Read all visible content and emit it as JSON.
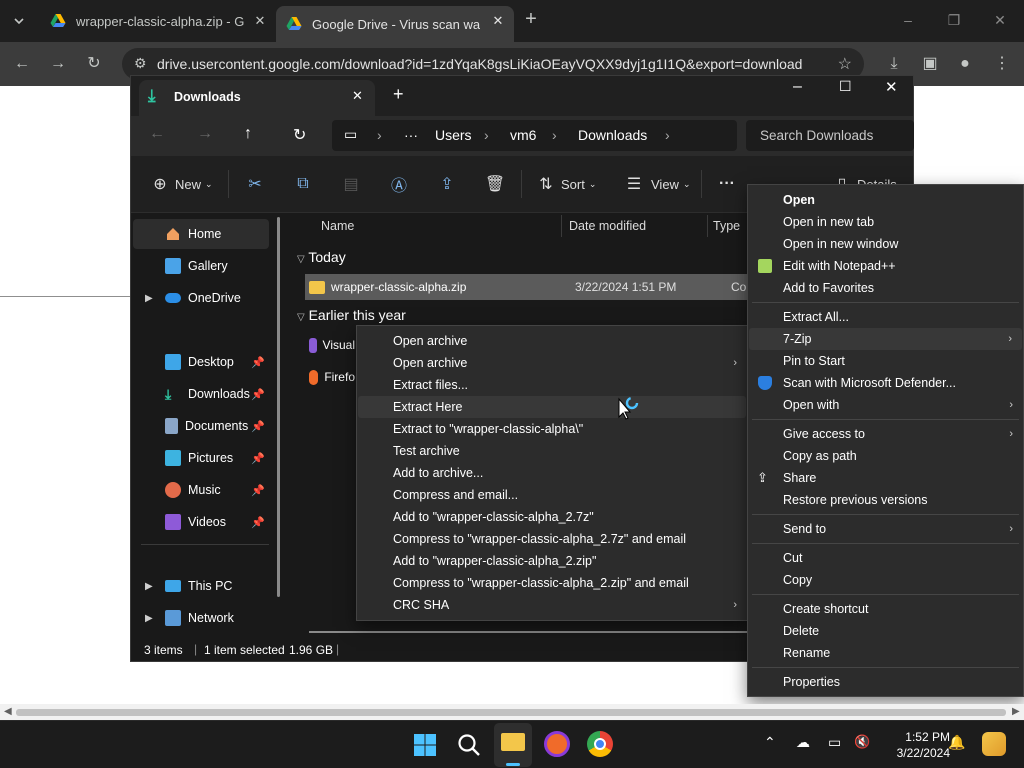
{
  "browser": {
    "tabs": [
      {
        "title": "wrapper-classic-alpha.zip - Goo",
        "close": "✕"
      },
      {
        "title": "Google Drive - Virus scan warni",
        "close": "✕"
      }
    ],
    "new_tab": "+",
    "url": "drive.usercontent.google.com/download?id=1zdYqaK8gsLiKiaOEayVQXX9dyj1g1I1Q&export=download"
  },
  "explorer": {
    "tab_title": "Downloads",
    "tab_close": "✕",
    "new_tab": "+",
    "breadcrumb": [
      "···",
      "Users",
      "vm6",
      "Downloads"
    ],
    "search_placeholder": "Search Downloads",
    "commands": {
      "new": "New",
      "sort": "Sort",
      "view": "View",
      "more": "···",
      "details": "Details"
    },
    "nav": [
      {
        "label": "Home"
      },
      {
        "label": "Gallery"
      },
      {
        "label": "OneDrive"
      },
      {
        "label": "Desktop"
      },
      {
        "label": "Downloads"
      },
      {
        "label": "Documents"
      },
      {
        "label": "Pictures"
      },
      {
        "label": "Music"
      },
      {
        "label": "Videos"
      },
      {
        "label": "This PC"
      },
      {
        "label": "Network"
      }
    ],
    "columns": {
      "name": "Name",
      "date": "Date modified",
      "type": "Type"
    },
    "groups": {
      "today": "Today",
      "earlier": "Earlier this year"
    },
    "files": [
      {
        "name": "wrapper-classic-alpha.zip",
        "date": "3/22/2024 1:51 PM",
        "type": "Comp"
      },
      {
        "name": "Visual"
      },
      {
        "name": "Firefo"
      }
    ],
    "status": {
      "items": "3 items",
      "selected": "1 item selected",
      "size": "1.96 GB"
    }
  },
  "zip_menu": {
    "items": [
      "Open archive",
      "Open archive",
      "Extract files...",
      "Extract Here",
      "Extract to \"wrapper-classic-alpha\\\"",
      "Test archive",
      "Add to archive...",
      "Compress and email...",
      "Add to \"wrapper-classic-alpha_2.7z\"",
      "Compress to \"wrapper-classic-alpha_2.7z\" and email",
      "Add to \"wrapper-classic-alpha_2.zip\"",
      "Compress to \"wrapper-classic-alpha_2.zip\" and email",
      "CRC SHA"
    ]
  },
  "context_menu": {
    "items": [
      "Open",
      "Open in new tab",
      "Open in new window",
      "Edit with Notepad++",
      "Add to Favorites",
      "Extract All...",
      "7-Zip",
      "Pin to Start",
      "Scan with Microsoft Defender...",
      "Open with",
      "Give access to",
      "Copy as path",
      "Share",
      "Restore previous versions",
      "Send to",
      "Cut",
      "Copy",
      "Create shortcut",
      "Delete",
      "Rename",
      "Properties"
    ]
  },
  "taskbar": {
    "time": "1:52 PM",
    "date": "3/22/2024"
  },
  "colors": {
    "accent": "#4cc2ff",
    "folder": "#f3c64a",
    "drive_green": "#1fa463"
  }
}
